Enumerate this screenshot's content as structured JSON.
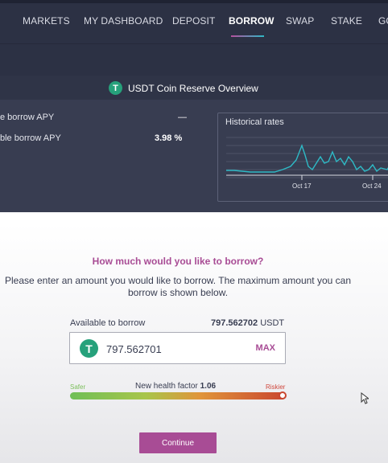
{
  "nav": {
    "items": [
      "MARKETS",
      "MY DASHBOARD",
      "DEPOSIT",
      "BORROW",
      "SWAP",
      "STAKE",
      "GO"
    ],
    "active": "BORROW"
  },
  "overview": {
    "title": "USDT Coin Reserve Overview",
    "icon": "tether-icon",
    "rows": [
      {
        "label": "e borrow APY",
        "value": "—"
      },
      {
        "label": "ble borrow APY",
        "value": "3.98 %"
      }
    ],
    "chart_title": "Historical rates",
    "chart_ticks": [
      "Oct 17",
      "Oct 24"
    ]
  },
  "borrow": {
    "question": "How much would you like to borrow?",
    "description": "Please enter an amount you would like to borrow. The maximum amount you can borrow is shown below.",
    "available_label": "Available to borrow",
    "available_value": "797.562702",
    "available_unit": "USDT",
    "amount_value": "797.562701",
    "max_label": "MAX",
    "safer_label": "Safer",
    "riskier_label": "Riskier",
    "health_label": "New health factor",
    "health_value": "1.06",
    "continue_label": "Continue"
  },
  "colors": {
    "nav_bg": "#2c3144",
    "panel_bg": "#383d51",
    "accent": "#a84c95",
    "tether": "#26a17b"
  }
}
